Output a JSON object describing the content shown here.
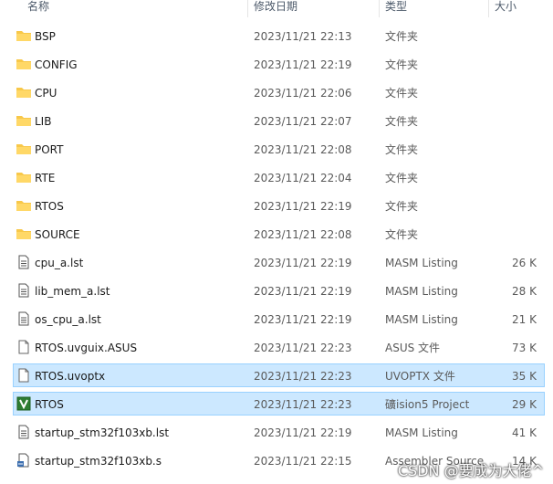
{
  "columns": {
    "name": "名称",
    "date": "修改日期",
    "type": "类型",
    "size": "大小"
  },
  "rows": [
    {
      "name": "BSP",
      "date": "2023/11/21 22:13",
      "type": "文件夹",
      "size": "",
      "icon": "folder-icon",
      "selected": false
    },
    {
      "name": "CONFIG",
      "date": "2023/11/21 22:19",
      "type": "文件夹",
      "size": "",
      "icon": "folder-icon",
      "selected": false
    },
    {
      "name": "CPU",
      "date": "2023/11/21 22:06",
      "type": "文件夹",
      "size": "",
      "icon": "folder-icon",
      "selected": false
    },
    {
      "name": "LIB",
      "date": "2023/11/21 22:07",
      "type": "文件夹",
      "size": "",
      "icon": "folder-icon",
      "selected": false
    },
    {
      "name": "PORT",
      "date": "2023/11/21 22:08",
      "type": "文件夹",
      "size": "",
      "icon": "folder-icon",
      "selected": false
    },
    {
      "name": "RTE",
      "date": "2023/11/21 22:04",
      "type": "文件夹",
      "size": "",
      "icon": "folder-icon",
      "selected": false
    },
    {
      "name": "RTOS",
      "date": "2023/11/21 22:19",
      "type": "文件夹",
      "size": "",
      "icon": "folder-icon",
      "selected": false
    },
    {
      "name": "SOURCE",
      "date": "2023/11/21 22:08",
      "type": "文件夹",
      "size": "",
      "icon": "folder-icon",
      "selected": false
    },
    {
      "name": "cpu_a.lst",
      "date": "2023/11/21 22:19",
      "type": "MASM Listing",
      "size": "26 K",
      "icon": "text-file-icon",
      "selected": false
    },
    {
      "name": "lib_mem_a.lst",
      "date": "2023/11/21 22:19",
      "type": "MASM Listing",
      "size": "28 K",
      "icon": "text-file-icon",
      "selected": false
    },
    {
      "name": "os_cpu_a.lst",
      "date": "2023/11/21 22:19",
      "type": "MASM Listing",
      "size": "21 K",
      "icon": "text-file-icon",
      "selected": false
    },
    {
      "name": "RTOS.uvguix.ASUS",
      "date": "2023/11/21 22:23",
      "type": "ASUS 文件",
      "size": "73 K",
      "icon": "blank-file-icon",
      "selected": false
    },
    {
      "name": "RTOS.uvoptx",
      "date": "2023/11/21 22:23",
      "type": "UVOPTX 文件",
      "size": "35 K",
      "icon": "blank-file-icon",
      "selected": true
    },
    {
      "name": "RTOS",
      "date": "2023/11/21 22:23",
      "type": "礦ision5 Project",
      "size": "29 K",
      "icon": "uvision-project-icon",
      "selected": true
    },
    {
      "name": "startup_stm32f103xb.lst",
      "date": "2023/11/21 22:19",
      "type": "MASM Listing",
      "size": "41 K",
      "icon": "text-file-icon",
      "selected": false
    },
    {
      "name": "startup_stm32f103xb.s",
      "date": "2023/11/21 22:15",
      "type": "Assembler Source",
      "size": "14 K",
      "icon": "assembler-file-icon",
      "selected": false
    }
  ],
  "watermark": "CSDN @要成为大佬^",
  "colors": {
    "selection_fill": "#cce8ff",
    "selection_border": "#99d1ff",
    "folder": "#f8c84a"
  }
}
